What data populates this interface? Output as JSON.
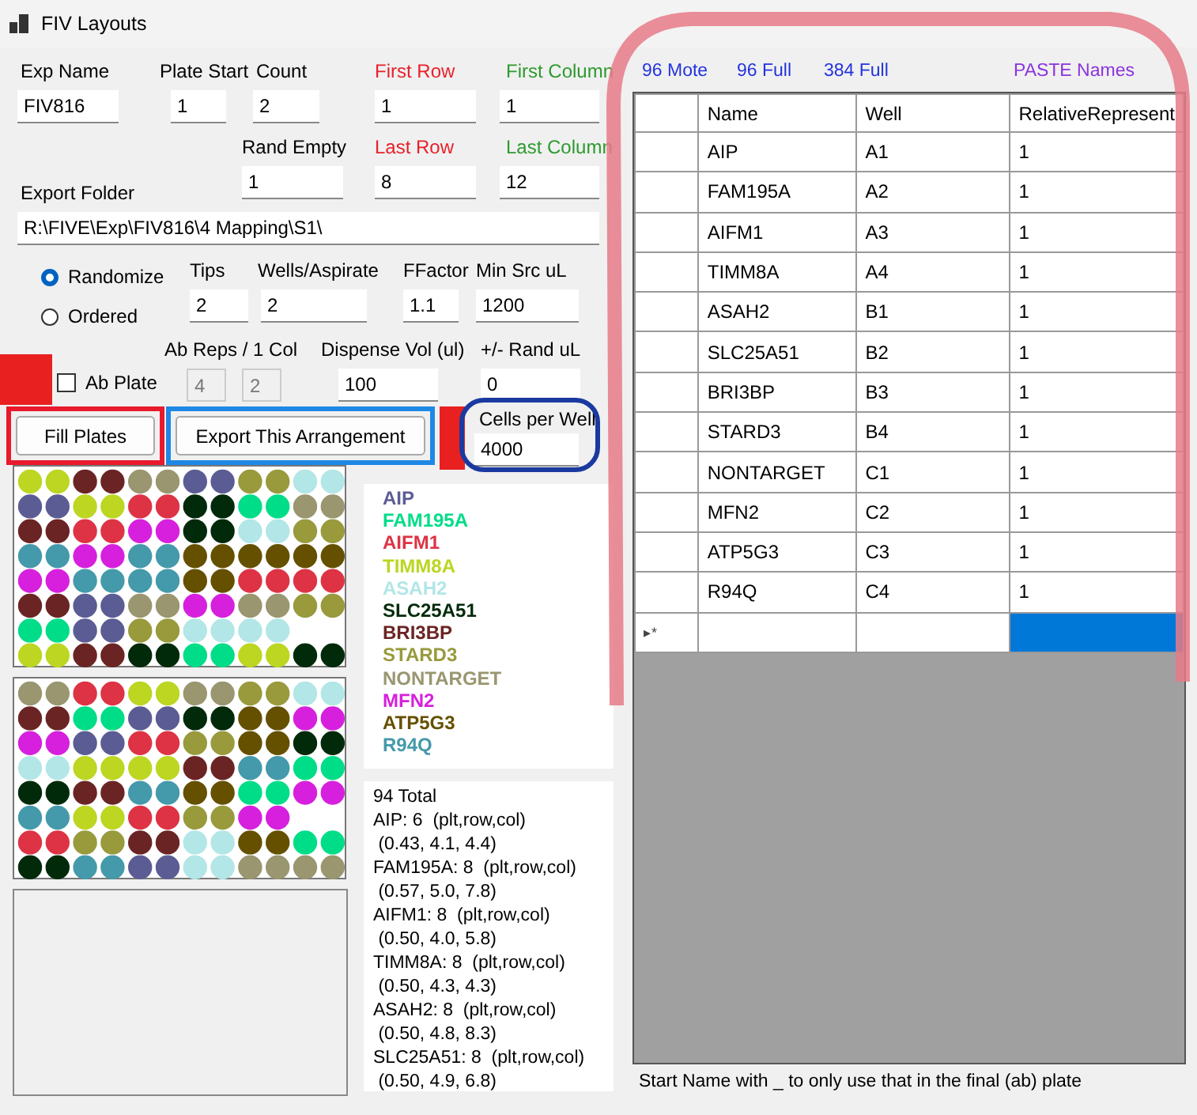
{
  "window": {
    "title": "FIV Layouts"
  },
  "top_fields": [
    {
      "label": "Exp Name",
      "value": "FIV816",
      "color": "#000000"
    },
    {
      "label": "Plate Start",
      "value": "1",
      "color": "#000000"
    },
    {
      "label": "Count",
      "value": "2",
      "color": "#000000"
    },
    {
      "label": "First Row",
      "value": "1",
      "color": "#e8202a"
    },
    {
      "label": "First Column",
      "value": "1",
      "color": "#2e9a2e"
    }
  ],
  "second_fields": [
    {
      "label": "Rand Empty",
      "value": "1",
      "color": "#000000"
    },
    {
      "label": "Last Row",
      "value": "8",
      "color": "#e8202a"
    },
    {
      "label": "Last Column",
      "value": "12",
      "color": "#2e9a2e"
    }
  ],
  "export_folder": {
    "label": "Export Folder",
    "value": "R:\\FIVE\\Exp\\FIV816\\4 Mapping\\S1\\"
  },
  "order_options": [
    {
      "label": "Randomize",
      "selected": true
    },
    {
      "label": "Ordered",
      "selected": false
    }
  ],
  "pipetting_fields": [
    {
      "label": "Tips",
      "value": "2"
    },
    {
      "label": "Wells/Aspirate",
      "value": "2"
    },
    {
      "label": "FFactor",
      "value": "1.1"
    },
    {
      "label": "Min Src uL",
      "value": "1200"
    }
  ],
  "ab_plate": {
    "label": "Ab Plate",
    "checked": false
  },
  "ab_reps": {
    "label": "Ab Reps / 1 Col",
    "values": [
      {
        "value": "4",
        "disabled": true
      },
      {
        "value": "2",
        "disabled": true
      }
    ]
  },
  "dispense_fields": [
    {
      "label": "Dispense Vol (ul)",
      "value": "100"
    },
    {
      "label": "+/- Rand uL",
      "value": "0"
    }
  ],
  "buttons": [
    {
      "label": "Fill Plates"
    },
    {
      "label": "Export This Arrangement"
    }
  ],
  "cells_per_well": {
    "label": "Cells per Well",
    "value": "4000"
  },
  "plates": [
    {
      "rows": [
        [
          {
            "color": "#bcd622"
          },
          {
            "color": "#bcd622"
          },
          {
            "color": "#6b2424"
          },
          {
            "color": "#6b2424"
          },
          {
            "color": "#999670"
          },
          {
            "color": "#999670"
          },
          {
            "color": "#5c5c94"
          },
          {
            "color": "#5c5c94"
          },
          {
            "color": "#989a3c"
          },
          {
            "color": "#989a3c"
          },
          {
            "color": "#b3e6e6"
          },
          {
            "color": "#b3e6e6"
          }
        ],
        [
          {
            "color": "#5c5c94"
          },
          {
            "color": "#5c5c94"
          },
          {
            "color": "#bcd622"
          },
          {
            "color": "#bcd622"
          },
          {
            "color": "#dd3344"
          },
          {
            "color": "#dd3344"
          },
          {
            "color": "#002a0a"
          },
          {
            "color": "#002a0a"
          },
          {
            "color": "#00dd88"
          },
          {
            "color": "#00dd88"
          },
          {
            "color": "#999670"
          },
          {
            "color": "#999670"
          }
        ],
        [
          {
            "color": "#6b2424"
          },
          {
            "color": "#6b2424"
          },
          {
            "color": "#dd3344"
          },
          {
            "color": "#dd3344"
          },
          {
            "color": "#d620dd"
          },
          {
            "color": "#d620dd"
          },
          {
            "color": "#002a0a"
          },
          {
            "color": "#002a0a"
          },
          {
            "color": "#b3e6e6"
          },
          {
            "color": "#b3e6e6"
          },
          {
            "color": "#989a3c"
          },
          {
            "color": "#989a3c"
          }
        ],
        [
          {
            "color": "#4499aa"
          },
          {
            "color": "#4499aa"
          },
          {
            "color": "#d620dd"
          },
          {
            "color": "#d620dd"
          },
          {
            "color": "#4499aa"
          },
          {
            "color": "#4499aa"
          },
          {
            "color": "#655000"
          },
          {
            "color": "#655000"
          },
          {
            "color": "#655000"
          },
          {
            "color": "#655000"
          },
          {
            "color": "#655000"
          },
          {
            "color": "#655000"
          }
        ],
        [
          {
            "color": "#d620dd"
          },
          {
            "color": "#d620dd"
          },
          {
            "color": "#4499aa"
          },
          {
            "color": "#4499aa"
          },
          {
            "color": "#4499aa"
          },
          {
            "color": "#4499aa"
          },
          {
            "color": "#655000"
          },
          {
            "color": "#655000"
          },
          {
            "color": "#dd3344"
          },
          {
            "color": "#dd3344"
          },
          {
            "color": "#dd3344"
          },
          {
            "color": "#dd3344"
          }
        ],
        [
          {
            "color": "#6b2424"
          },
          {
            "color": "#6b2424"
          },
          {
            "color": "#5c5c94"
          },
          {
            "color": "#5c5c94"
          },
          {
            "color": "#999670"
          },
          {
            "color": "#999670"
          },
          {
            "color": "#d620dd"
          },
          {
            "color": "#d620dd"
          },
          {
            "color": "#999670"
          },
          {
            "color": "#999670"
          },
          {
            "color": "#989a3c"
          },
          {
            "color": "#989a3c"
          }
        ],
        [
          {
            "color": "#00dd88"
          },
          {
            "color": "#00dd88"
          },
          {
            "color": "#5c5c94"
          },
          {
            "color": "#5c5c94"
          },
          {
            "color": "#989a3c"
          },
          {
            "color": "#989a3c"
          },
          {
            "color": "#b3e6e6"
          },
          {
            "color": "#b3e6e6"
          },
          {
            "color": "#b3e6e6"
          },
          {
            "color": "#b3e6e6"
          },
          null,
          null
        ],
        [
          {
            "color": "#bcd622"
          },
          {
            "color": "#bcd622"
          },
          {
            "color": "#6b2424"
          },
          {
            "color": "#6b2424"
          },
          {
            "color": "#002a0a"
          },
          {
            "color": "#002a0a"
          },
          {
            "color": "#00dd88"
          },
          {
            "color": "#00dd88"
          },
          {
            "color": "#bcd622"
          },
          {
            "color": "#bcd622"
          },
          {
            "color": "#002a0a"
          },
          {
            "color": "#002a0a"
          }
        ]
      ]
    },
    {
      "rows": [
        [
          {
            "color": "#999670"
          },
          {
            "color": "#999670"
          },
          {
            "color": "#dd3344"
          },
          {
            "color": "#dd3344"
          },
          {
            "color": "#bcd622"
          },
          {
            "color": "#bcd622"
          },
          {
            "color": "#999670"
          },
          {
            "color": "#999670"
          },
          {
            "color": "#989a3c"
          },
          {
            "color": "#989a3c"
          },
          {
            "color": "#b3e6e6"
          },
          {
            "color": "#b3e6e6"
          }
        ],
        [
          {
            "color": "#6b2424"
          },
          {
            "color": "#6b2424"
          },
          {
            "color": "#00dd88"
          },
          {
            "color": "#00dd88"
          },
          {
            "color": "#5c5c94"
          },
          {
            "color": "#5c5c94"
          },
          {
            "color": "#002a0a"
          },
          {
            "color": "#002a0a"
          },
          {
            "color": "#655000"
          },
          {
            "color": "#655000"
          },
          {
            "color": "#d620dd"
          },
          {
            "color": "#d620dd"
          }
        ],
        [
          {
            "color": "#d620dd"
          },
          {
            "color": "#d620dd"
          },
          {
            "color": "#5c5c94"
          },
          {
            "color": "#5c5c94"
          },
          {
            "color": "#dd3344"
          },
          {
            "color": "#dd3344"
          },
          {
            "color": "#989a3c"
          },
          {
            "color": "#989a3c"
          },
          {
            "color": "#655000"
          },
          {
            "color": "#655000"
          },
          {
            "color": "#002a0a"
          },
          {
            "color": "#002a0a"
          }
        ],
        [
          {
            "color": "#b3e6e6"
          },
          {
            "color": "#b3e6e6"
          },
          {
            "color": "#bcd622"
          },
          {
            "color": "#bcd622"
          },
          {
            "color": "#bcd622"
          },
          {
            "color": "#bcd622"
          },
          {
            "color": "#6b2424"
          },
          {
            "color": "#6b2424"
          },
          {
            "color": "#4499aa"
          },
          {
            "color": "#4499aa"
          },
          {
            "color": "#00dd88"
          },
          {
            "color": "#00dd88"
          }
        ],
        [
          {
            "color": "#002a0a"
          },
          {
            "color": "#002a0a"
          },
          {
            "color": "#6b2424"
          },
          {
            "color": "#6b2424"
          },
          {
            "color": "#4499aa"
          },
          {
            "color": "#4499aa"
          },
          {
            "color": "#655000"
          },
          {
            "color": "#655000"
          },
          {
            "color": "#00dd88"
          },
          {
            "color": "#00dd88"
          },
          {
            "color": "#d620dd"
          },
          {
            "color": "#d620dd"
          }
        ],
        [
          {
            "color": "#4499aa"
          },
          {
            "color": "#4499aa"
          },
          {
            "color": "#bcd622"
          },
          {
            "color": "#bcd622"
          },
          {
            "color": "#dd3344"
          },
          {
            "color": "#dd3344"
          },
          {
            "color": "#989a3c"
          },
          {
            "color": "#989a3c"
          },
          {
            "color": "#d620dd"
          },
          {
            "color": "#d620dd"
          },
          null,
          null
        ],
        [
          {
            "color": "#dd3344"
          },
          {
            "color": "#dd3344"
          },
          {
            "color": "#989a3c"
          },
          {
            "color": "#989a3c"
          },
          {
            "color": "#6b2424"
          },
          {
            "color": "#6b2424"
          },
          {
            "color": "#b3e6e6"
          },
          {
            "color": "#b3e6e6"
          },
          {
            "color": "#655000"
          },
          {
            "color": "#655000"
          },
          {
            "color": "#00dd88"
          },
          {
            "color": "#00dd88"
          }
        ],
        [
          {
            "color": "#002a0a"
          },
          {
            "color": "#002a0a"
          },
          {
            "color": "#4499aa"
          },
          {
            "color": "#4499aa"
          },
          {
            "color": "#5c5c94"
          },
          {
            "color": "#5c5c94"
          },
          {
            "color": "#b3e6e6"
          },
          {
            "color": "#b3e6e6"
          },
          {
            "color": "#999670"
          },
          {
            "color": "#999670"
          },
          {
            "color": "#999670"
          },
          {
            "color": "#999670"
          }
        ]
      ]
    }
  ],
  "legend": [
    {
      "name": "AIP",
      "color": "#5c5c94"
    },
    {
      "name": "FAM195A",
      "color": "#00dd88"
    },
    {
      "name": "AIFM1",
      "color": "#dd3344"
    },
    {
      "name": "TIMM8A",
      "color": "#bcd622"
    },
    {
      "name": "ASAH2",
      "color": "#b3e6e6"
    },
    {
      "name": "SLC25A51",
      "color": "#002a0a"
    },
    {
      "name": "BRI3BP",
      "color": "#6b2424"
    },
    {
      "name": "STARD3",
      "color": "#989a3c"
    },
    {
      "name": "NONTARGET",
      "color": "#999670"
    },
    {
      "name": "MFN2",
      "color": "#d620dd"
    },
    {
      "name": "ATP5G3",
      "color": "#655000"
    },
    {
      "name": "R94Q",
      "color": "#4499aa"
    }
  ],
  "stats": [
    "94 Total",
    "AIP: 6  (plt,row,col)",
    " (0.43, 4.1, 4.4)",
    "FAM195A: 8  (plt,row,col)",
    " (0.57, 5.0, 7.8)",
    "AIFM1: 8  (plt,row,col)",
    " (0.50, 4.0, 5.8)",
    "TIMM8A: 8  (plt,row,col)",
    " (0.50, 4.3, 4.3)",
    "ASAH2: 8  (plt,row,col)",
    " (0.50, 4.8, 8.3)",
    "SLC25A51: 8  (plt,row,col)",
    " (0.50, 4.9, 6.8)"
  ],
  "links": [
    {
      "label": "96 Mote",
      "color": "#2233dd"
    },
    {
      "label": "96 Full",
      "color": "#2233dd"
    },
    {
      "label": "384 Full",
      "color": "#2233dd"
    },
    {
      "label": "PASTE Names",
      "color": "#8a33dd"
    }
  ],
  "table": {
    "columns": [
      "Name",
      "Well",
      "RelativeRepresent"
    ],
    "rows": [
      {
        "name": "AIP",
        "well": "A1",
        "relative": "1"
      },
      {
        "name": "FAM195A",
        "well": "A2",
        "relative": "1"
      },
      {
        "name": "AIFM1",
        "well": "A3",
        "relative": "1"
      },
      {
        "name": "TIMM8A",
        "well": "A4",
        "relative": "1"
      },
      {
        "name": "ASAH2",
        "well": "B1",
        "relative": "1"
      },
      {
        "name": "SLC25A51",
        "well": "B2",
        "relative": "1"
      },
      {
        "name": "BRI3BP",
        "well": "B3",
        "relative": "1"
      },
      {
        "name": "STARD3",
        "well": "B4",
        "relative": "1"
      },
      {
        "name": "NONTARGET",
        "well": "C1",
        "relative": "1"
      },
      {
        "name": "MFN2",
        "well": "C2",
        "relative": "1"
      },
      {
        "name": "ATP5G3",
        "well": "C3",
        "relative": "1"
      },
      {
        "name": "R94Q",
        "well": "C4",
        "relative": "1"
      }
    ],
    "new_row": {
      "marker": "▸*",
      "cells": [
        {
          "selected": false
        },
        {
          "selected": false
        },
        {
          "selected": true
        }
      ]
    }
  },
  "hint": "Start Name with _ to only use that in the final (ab) plate"
}
